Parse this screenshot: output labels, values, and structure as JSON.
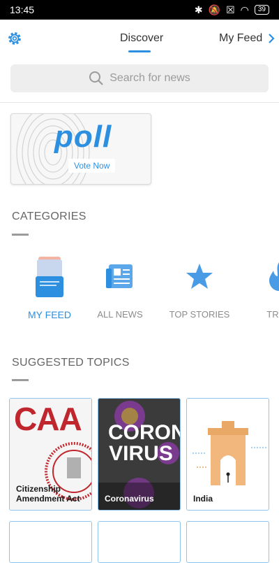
{
  "status": {
    "time": "13:45",
    "battery": "39"
  },
  "header": {
    "tab_discover": "Discover",
    "tab_myfeed": "My Feed"
  },
  "search": {
    "placeholder": "Search for news"
  },
  "poll": {
    "title": "poll",
    "vote_label": "Vote Now"
  },
  "categories": {
    "title": "CATEGORIES",
    "items": [
      {
        "label": "MY FEED",
        "icon": "my-feed-icon"
      },
      {
        "label": "ALL NEWS",
        "icon": "newspaper-icon"
      },
      {
        "label": "TOP STORIES",
        "icon": "star-icon"
      },
      {
        "label": "TREN",
        "icon": "flame-icon"
      }
    ]
  },
  "topics": {
    "title": "SUGGESTED TOPICS",
    "items": [
      {
        "label": "Citizenship Amendment Act",
        "image_text": "CAA"
      },
      {
        "label": "Coronavirus",
        "image_text": "CORONA VIRUS"
      },
      {
        "label": "India",
        "image_text": ""
      }
    ]
  },
  "colors": {
    "accent": "#2d8fe0",
    "caa_red": "#c0262d",
    "virus_purple": "#7a3a8e"
  }
}
